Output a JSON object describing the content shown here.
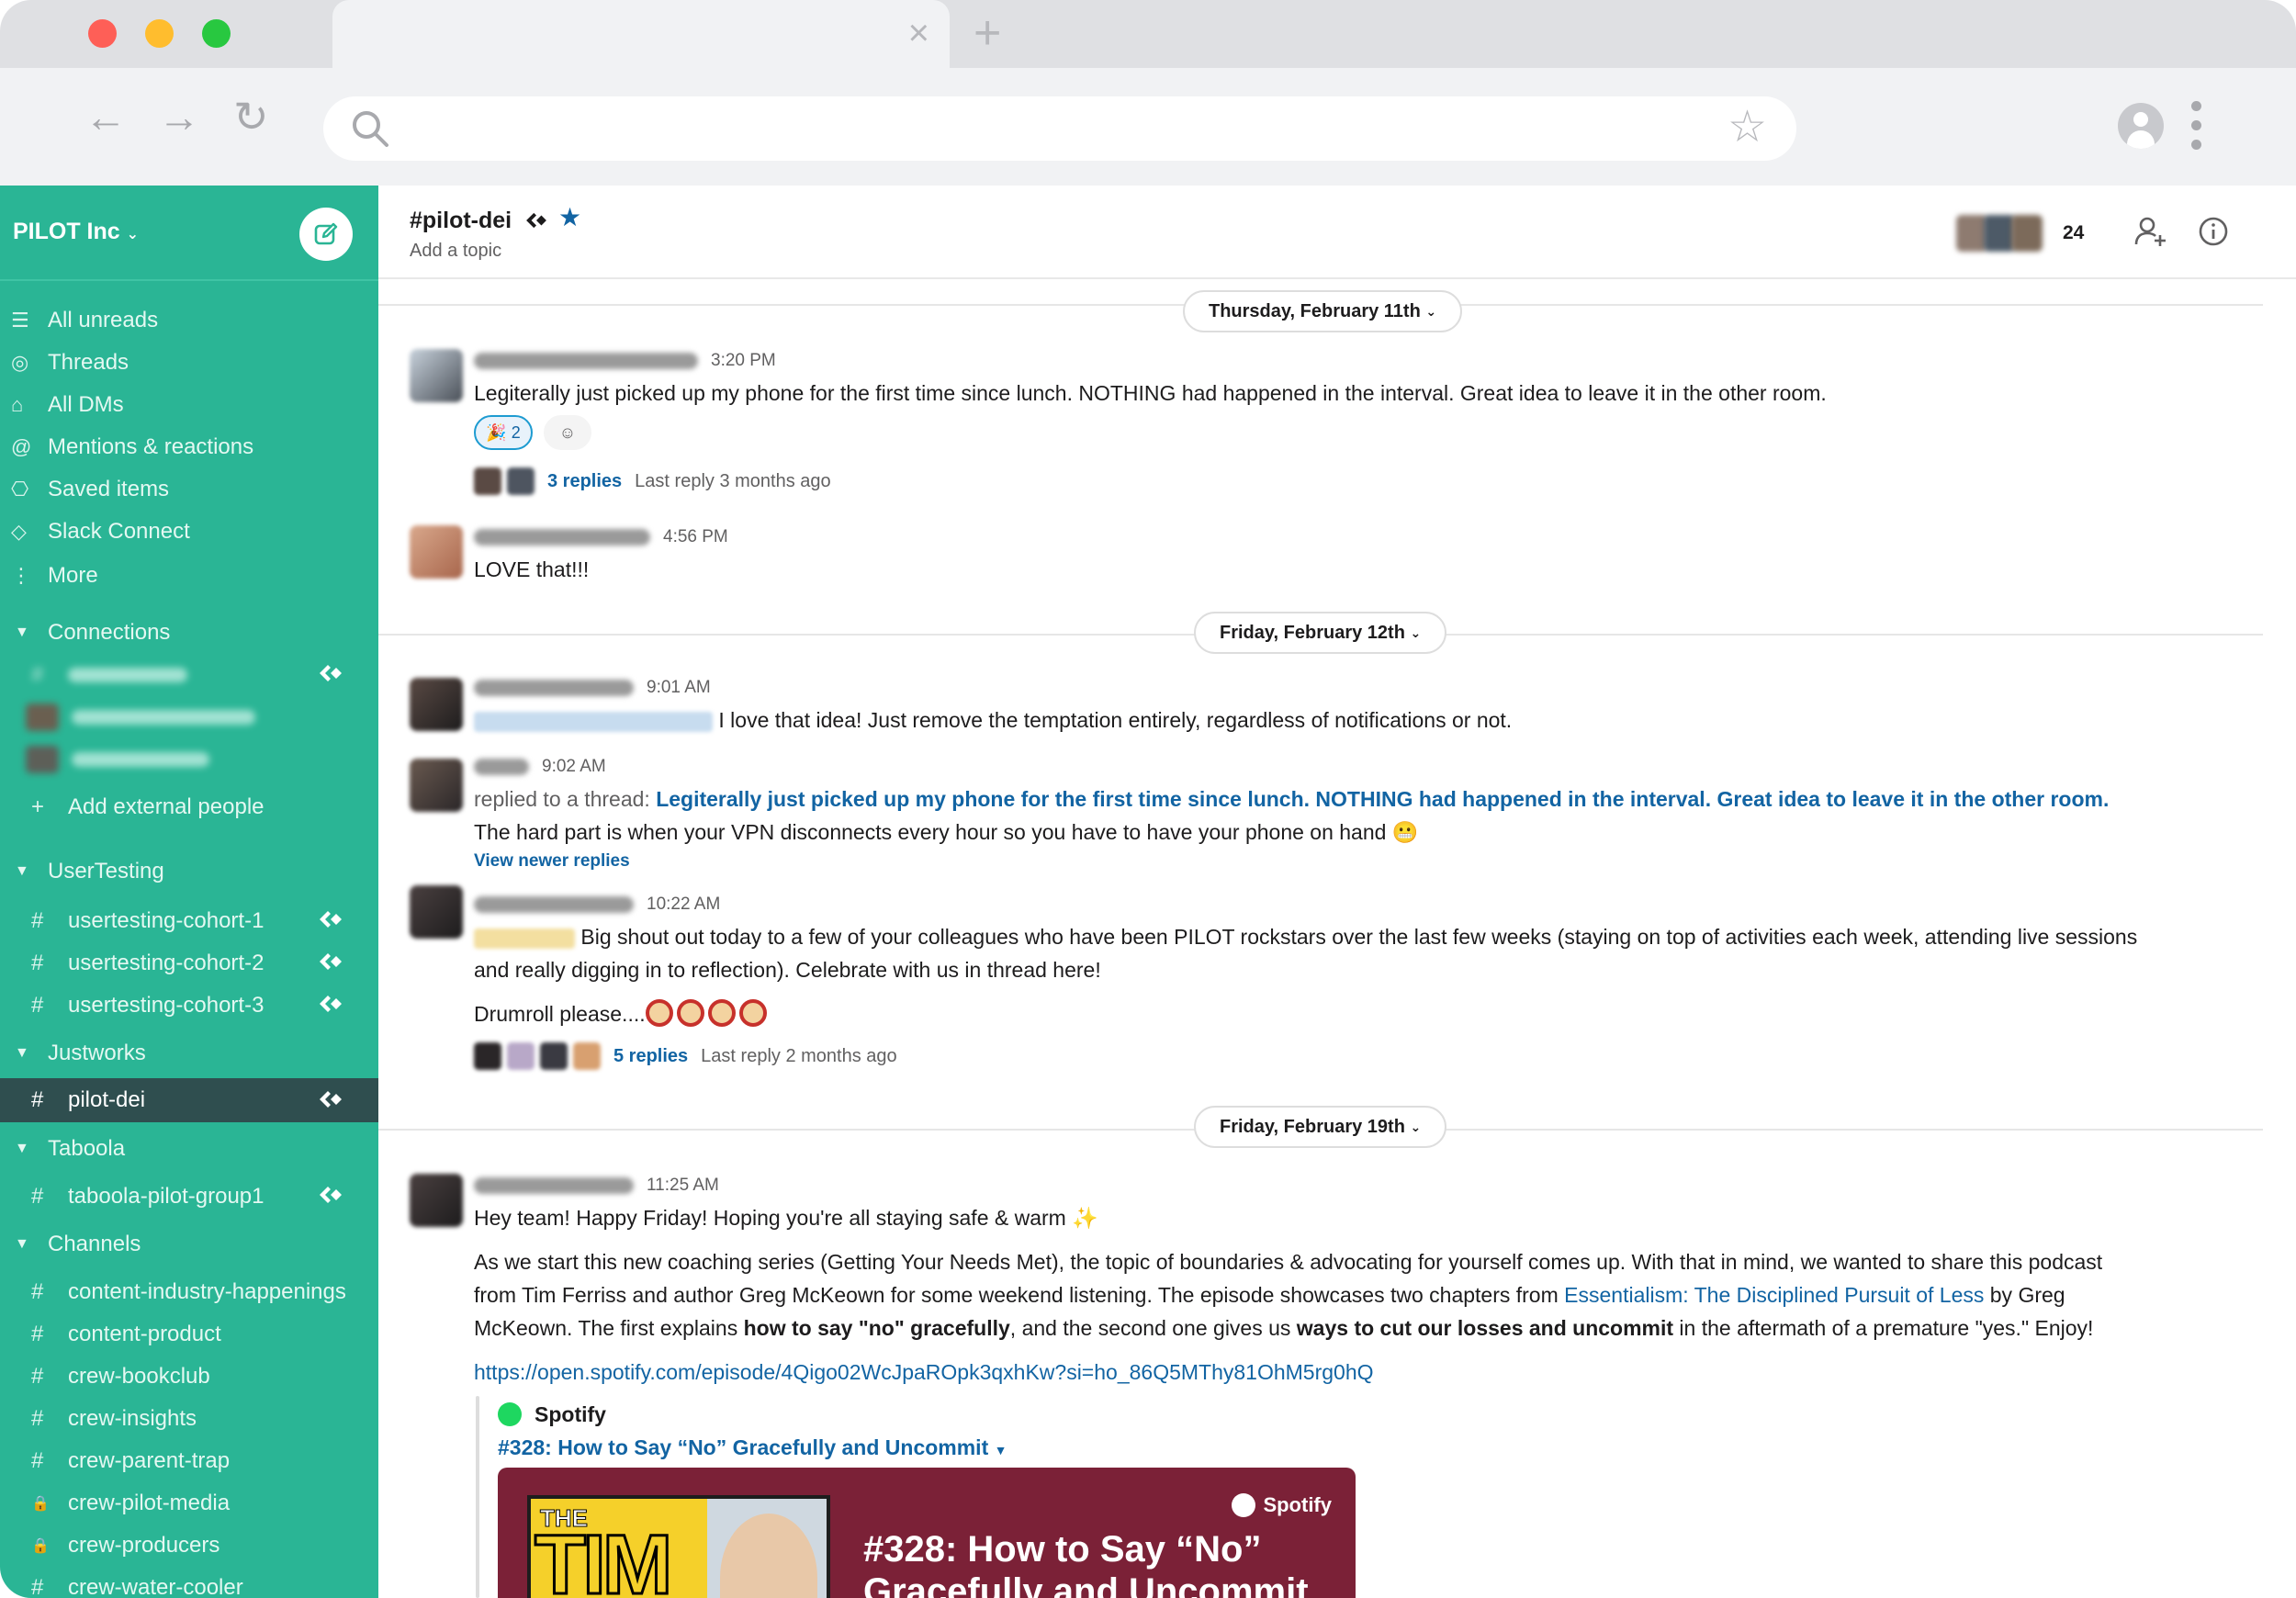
{
  "browser": {
    "tab_close": "×",
    "new_tab": "+",
    "back": "←",
    "forward": "→",
    "reload": "↻",
    "bookmark_star": "☆"
  },
  "sidebar": {
    "workspace": "PILOT Inc",
    "nav": [
      {
        "icon": "☰",
        "label": "All unreads"
      },
      {
        "icon": "◎",
        "label": "Threads"
      },
      {
        "icon": "⌂",
        "label": "All DMs"
      },
      {
        "icon": "@",
        "label": "Mentions & reactions"
      },
      {
        "icon": "⎔",
        "label": "Saved items"
      },
      {
        "icon": "◇",
        "label": "Slack Connect"
      },
      {
        "icon": "⋮",
        "label": "More"
      }
    ],
    "sections": {
      "connections": "Connections",
      "add_external": "Add external people",
      "usertesting": "UserTesting",
      "justworks": "Justworks",
      "taboola": "Taboola",
      "channels": "Channels"
    },
    "usertesting_channels": [
      "usertesting-cohort-1",
      "usertesting-cohort-2",
      "usertesting-cohort-3"
    ],
    "justworks_channels": [
      "pilot-dei"
    ],
    "taboola_channels": [
      "taboola-pilot-group1"
    ],
    "channels": [
      {
        "prefix": "#",
        "label": "content-industry-happenings"
      },
      {
        "prefix": "#",
        "label": "content-product"
      },
      {
        "prefix": "#",
        "label": "crew-bookclub"
      },
      {
        "prefix": "#",
        "label": "crew-insights"
      },
      {
        "prefix": "#",
        "label": "crew-parent-trap"
      },
      {
        "prefix": "🔒",
        "label": "crew-pilot-media"
      },
      {
        "prefix": "🔒",
        "label": "crew-producers"
      },
      {
        "prefix": "#",
        "label": "crew-water-cooler"
      }
    ]
  },
  "channel": {
    "name": "#pilot-dei",
    "topic": "Add a topic",
    "member_count": "24"
  },
  "dates": [
    "Thursday, February 11th",
    "Friday, February 12th",
    "Friday, February 19th"
  ],
  "messages": {
    "m1": {
      "time": "3:20 PM",
      "text": "Legiterally just picked up my phone for the first time since lunch. NOTHING had happened in the interval. Great idea to leave it  in the other room.",
      "reaction_count": "2",
      "replies": "3 replies",
      "last_reply": "Last reply 3 months ago"
    },
    "m2": {
      "time": "4:56 PM",
      "text": "LOVE that!!!"
    },
    "m3": {
      "time": "9:01 AM",
      "text": "I love that idea! Just remove the temptation entirely, regardless of notifications or not."
    },
    "m4": {
      "time": "9:02 AM",
      "replied_prefix": "replied to a thread:",
      "replied_link": "Legiterally just picked up my phone for the first time since lunch. NOTHING had happened in the interval. Great idea to leave it in the other room.",
      "text": "The hard part is when your VPN disconnects every hour so you have to have your phone on hand",
      "view_newer": "View newer replies"
    },
    "m5": {
      "time": "10:22 AM",
      "text_line1": "Big shout out today to a few of your colleagues who have been PILOT rockstars over the last few weeks (staying on top of activities each week, attending live sessions",
      "text_line2": "and really digging in to reflection). Celebrate with us in thread here!",
      "drumroll": "Drumroll please....",
      "replies": "5 replies",
      "last_reply": "Last reply 2 months ago"
    },
    "m6": {
      "time": "11:25 AM",
      "greeting": "Hey team! Happy Friday! Hoping you're all staying safe & warm",
      "p1_line1": "As we start this new coaching series (Getting Your Needs Met), the topic of boundaries & advocating for yourself comes up. With that in mind, we wanted to share this podcast",
      "p1_line2a": "from Tim Ferriss and author Greg McKeown for some weekend listening. The episode showcases two chapters from ",
      "p1_link": "Essentialism: The Disciplined Pursuit of Less",
      "p1_line2b": " by Greg",
      "p1_line3a": "McKeown. The first explains ",
      "p1_bold1": "how to say \"no\" gracefully",
      "p1_line3b": ", and the second one gives us ",
      "p1_bold2": "ways to cut our losses and uncommit",
      "p1_line3c": " in the aftermath of a premature \"yes.\" Enjoy!",
      "url": "https://open.spotify.com/episode/4Qigo02WcJpaROpk3qxhKw?si=ho_86Q5MThy81OhM5rg0hQ",
      "attachment_source": "Spotify",
      "attachment_title": "#328: How to Say “No” Gracefully and Uncommit",
      "card_brand": "Spotify",
      "card_title": "#328: How to Say “No” Gracefully and Uncommit",
      "cover_the": "THE",
      "cover_tim": "TIM"
    }
  }
}
